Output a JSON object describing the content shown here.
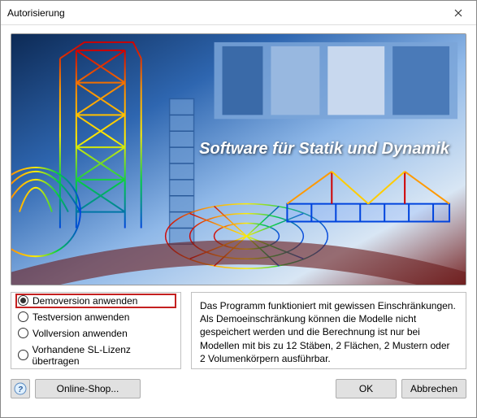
{
  "window": {
    "title": "Autorisierung"
  },
  "banner": {
    "slogan": "Software für Statik und Dynamik"
  },
  "options": {
    "items": [
      {
        "label": "Demoversion anwenden",
        "checked": true,
        "highlight": true
      },
      {
        "label": "Testversion anwenden",
        "checked": false,
        "highlight": false
      },
      {
        "label": "Vollversion anwenden",
        "checked": false,
        "highlight": false
      },
      {
        "label": "Vorhandene SL-Lizenz übertragen",
        "checked": false,
        "highlight": false
      }
    ]
  },
  "description": {
    "text": "Das Programm funktioniert mit gewissen Einschränkungen. Als Demoeinschränkung können die Modelle nicht gespeichert werden und die Berechnung ist nur bei Modellen mit bis zu 12 Stäben, 2 Flächen, 2 Mustern oder 2 Volumenkörpern ausführbar."
  },
  "footer": {
    "shop": "Online-Shop...",
    "ok": "OK",
    "cancel": "Abbrechen"
  }
}
